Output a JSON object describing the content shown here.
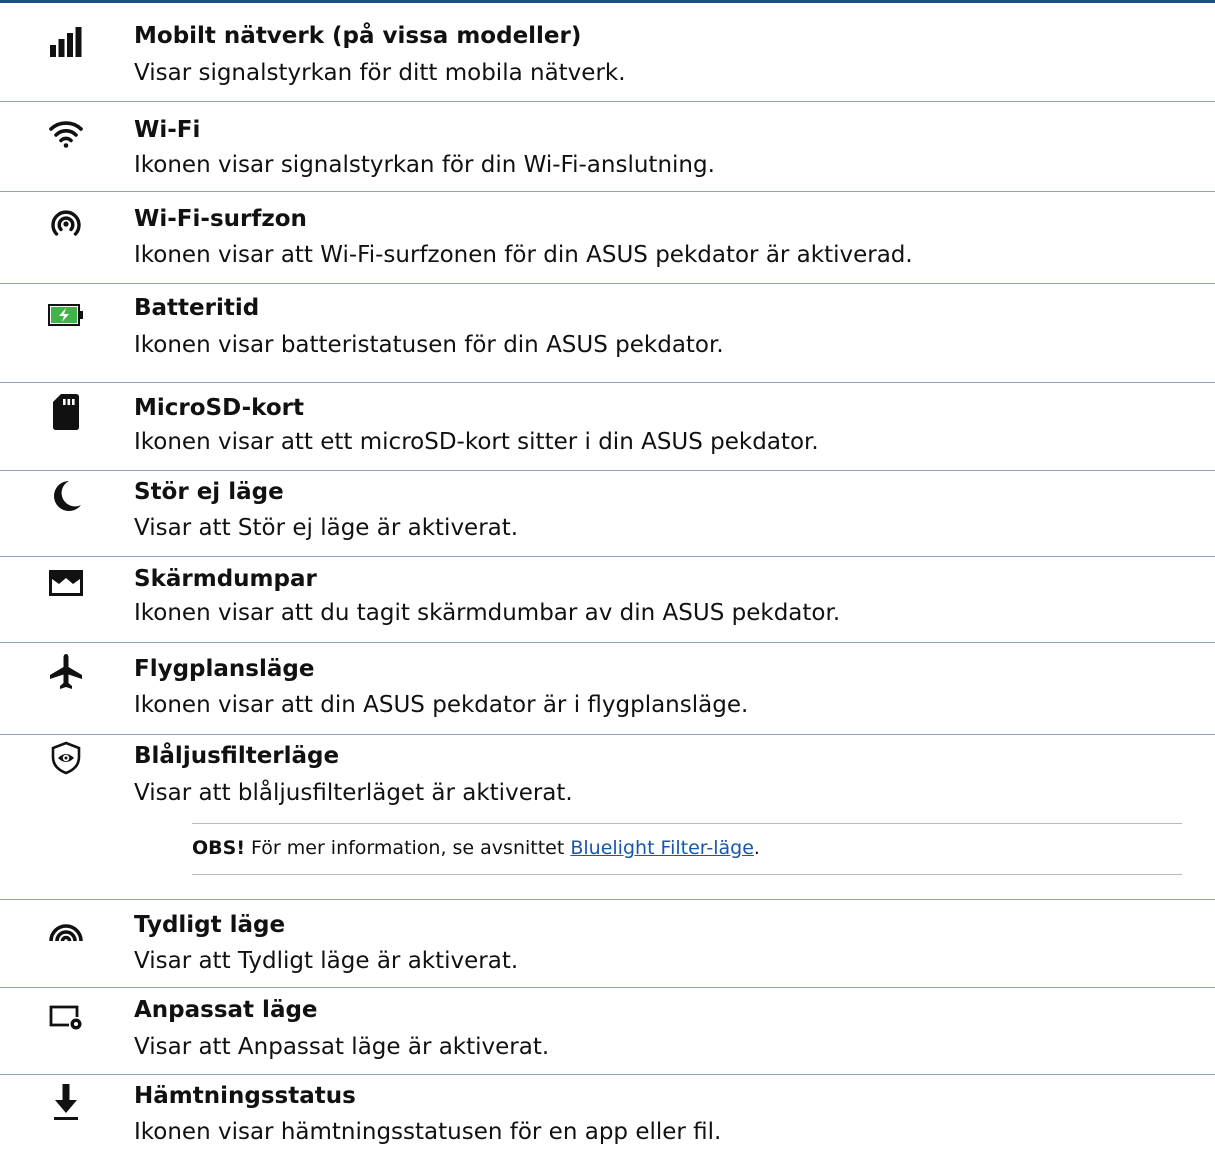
{
  "items": [
    {
      "icon": "cellular-signal-icon",
      "title": "Mobilt nätverk (på vissa modeller)",
      "desc": "Visar signalstyrkan för ditt mobila nätverk."
    },
    {
      "icon": "wifi-icon",
      "title": "Wi-Fi",
      "desc": "Ikonen visar signalstyrkan för din Wi-Fi-anslutning."
    },
    {
      "icon": "hotspot-icon",
      "title": "Wi-Fi-surfzon",
      "desc": "Ikonen visar att Wi-Fi-surfzonen för din ASUS pekdator är aktiverad."
    },
    {
      "icon": "battery-charging-icon",
      "title": "Batteritid",
      "desc": "Ikonen visar batteristatusen för din ASUS pekdator."
    },
    {
      "icon": "sd-card-icon",
      "title": "MicroSD-kort",
      "desc": "Ikonen visar att ett microSD-kort sitter i din ASUS pekdator."
    },
    {
      "icon": "moon-icon",
      "title": "Stör ej läge",
      "desc": "Visar att Stör ej läge är aktiverat."
    },
    {
      "icon": "screenshot-icon",
      "title": "Skärmdumpar",
      "desc": "Ikonen visar att du tagit skärmdumbar av din ASUS pekdator."
    },
    {
      "icon": "airplane-icon",
      "title": "Flygplansläge",
      "desc": "Ikonen visar att din ASUS pekdator är i flygplansläge."
    },
    {
      "icon": "eye-shield-icon",
      "title": "Blåljusfilterläge",
      "desc": "Visar att blåljusfilterläget är aktiverat."
    },
    {
      "icon": "vivid-mode-icon",
      "title": "Tydligt läge",
      "desc": "Visar att Tydligt läge är aktiverat."
    },
    {
      "icon": "custom-mode-icon",
      "title": "Anpassat läge",
      "desc": "Visar att Anpassat läge är aktiverat."
    },
    {
      "icon": "download-icon",
      "title": "Hämtningsstatus",
      "desc": "Ikonen visar hämtningsstatusen för en app eller fil."
    }
  ],
  "note": {
    "label": "OBS!",
    "text": " För mer information, se avsnittet ",
    "link": "Bluelight Filter-läge",
    "end": "."
  },
  "colors": {
    "rule": "#1d4f86",
    "separator": "#8ea4c1",
    "link": "#1a56a8",
    "battery": "#3fb54a"
  }
}
